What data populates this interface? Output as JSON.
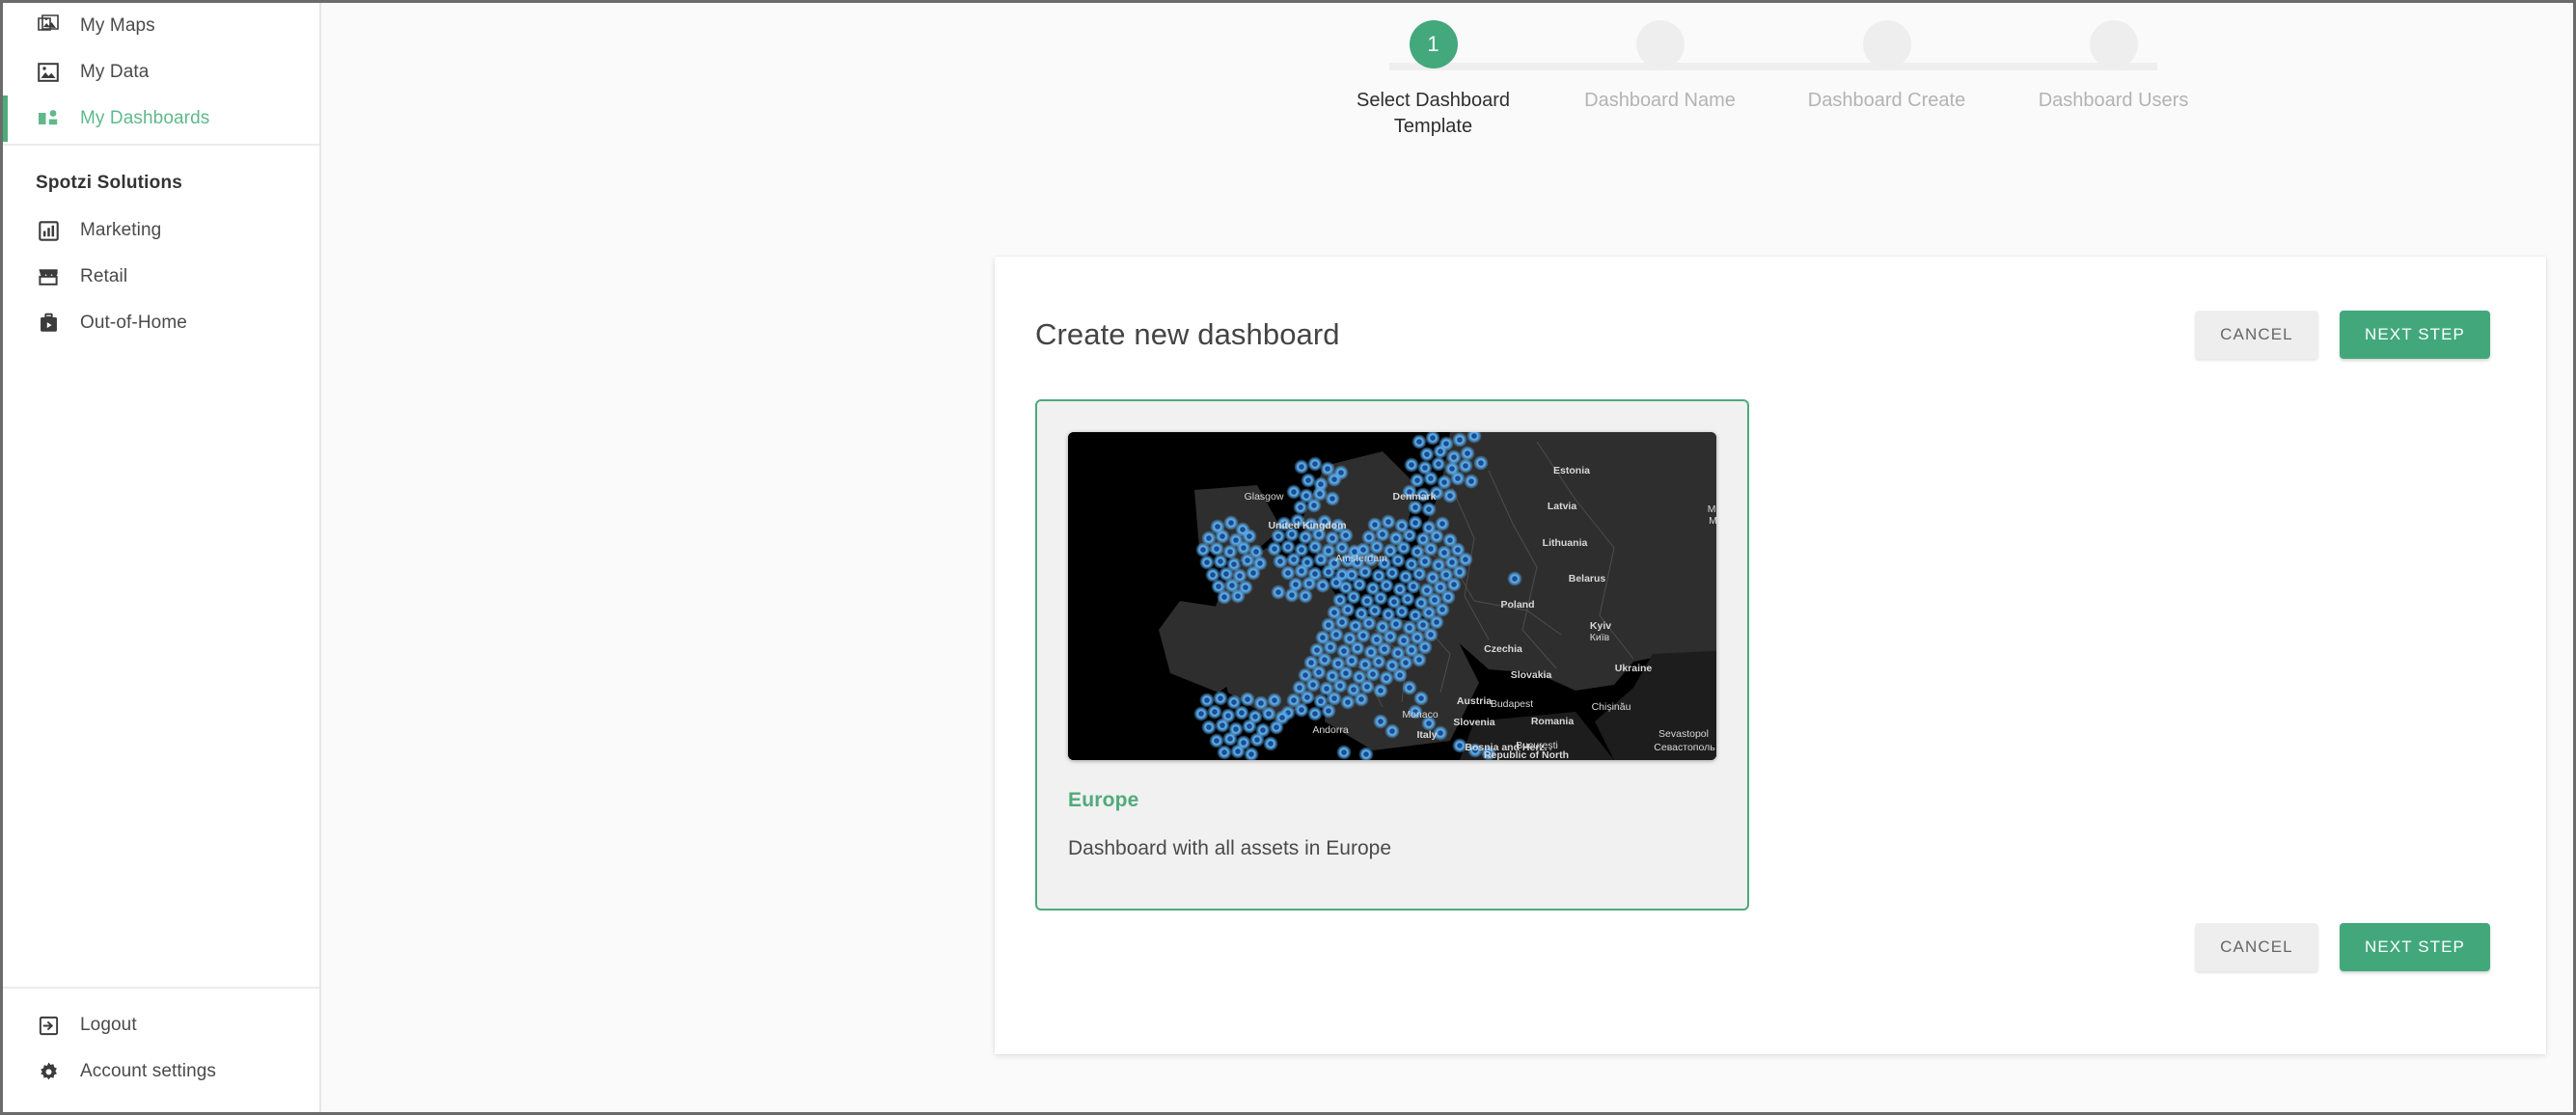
{
  "sidebar": {
    "top_items": [
      {
        "label": "My Maps",
        "icon": "maps-icon",
        "active": false
      },
      {
        "label": "My Data",
        "icon": "data-icon",
        "active": false
      },
      {
        "label": "My Dashboards",
        "icon": "dashboards-icon",
        "active": true
      }
    ],
    "section_title": "Spotzi Solutions",
    "solution_items": [
      {
        "label": "Marketing",
        "icon": "chart-icon"
      },
      {
        "label": "Retail",
        "icon": "store-icon"
      },
      {
        "label": "Out-of-Home",
        "icon": "briefcase-icon"
      }
    ],
    "bottom_items": [
      {
        "label": "Logout",
        "icon": "logout-icon"
      },
      {
        "label": "Account settings",
        "icon": "gear-icon"
      }
    ]
  },
  "stepper": {
    "steps": [
      {
        "number": "1",
        "label": "Select Dashboard Template",
        "state": "current"
      },
      {
        "number": "2",
        "label": "Dashboard Name",
        "state": "upcoming"
      },
      {
        "number": "3",
        "label": "Dashboard Create",
        "state": "upcoming"
      },
      {
        "number": "4",
        "label": "Dashboard Users",
        "state": "upcoming"
      }
    ]
  },
  "panel": {
    "title": "Create new dashboard",
    "cancel_label": "CANCEL",
    "next_label": "NEXT STEP",
    "footer_cancel_label": "CANCEL",
    "footer_next_label": "NEXT STEP"
  },
  "templates": [
    {
      "name": "Europe",
      "description": "Dashboard with all assets in Europe",
      "selected": true,
      "thumbnail": {
        "basemap": "dark",
        "point_color": "#5aa9e8",
        "point_core_color": "#1b4d8f",
        "labels": [
          "Estonia",
          "Latvia",
          "Lithuania",
          "Belarus",
          "Poland",
          "Czechia",
          "Slovakia",
          "Austria",
          "Budapest",
          "Romania",
          "Bucuresti",
          "Ukraine",
          "Kyiv",
          "Київ",
          "Chișinău",
          "Sevastopol",
          "Севастополь",
          "Bosnia and Herz.",
          "Republic of North Macedonia",
          "Italy",
          "Andorra",
          "Monaco",
          "Slovenia",
          "Denmark",
          "United Kingdom",
          "Glasgow",
          "Amsterdam",
          "Moscow",
          "Москва"
        ]
      }
    }
  ],
  "colors": {
    "accent_green": "#42a87c",
    "accent_green_light": "#5fb98a",
    "page_bg": "#fafafa",
    "panel_bg": "#ffffff",
    "card_bg": "#f0f1f0",
    "muted_text": "#b3b3b3"
  }
}
